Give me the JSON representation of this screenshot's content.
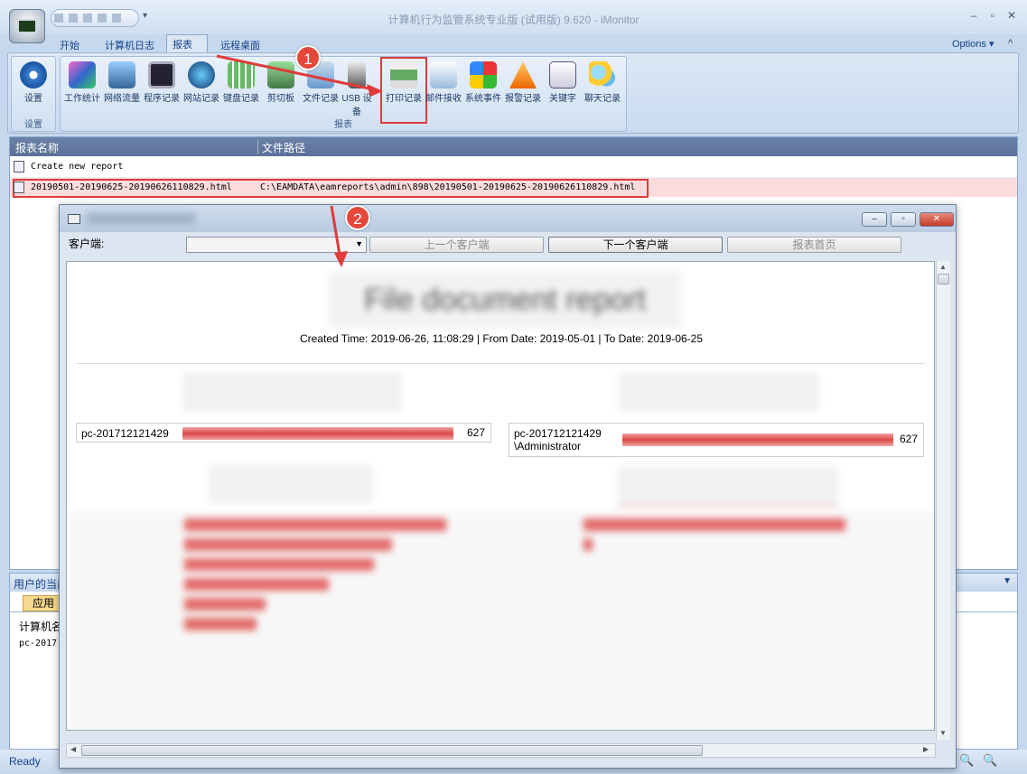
{
  "window": {
    "title": "计算机行为监管系统专业版 (试用版) 9.620 - iMonitor",
    "options_label": "Options"
  },
  "tabs": [
    {
      "label": "开始"
    },
    {
      "label": "计算机日志"
    },
    {
      "label": "报表"
    },
    {
      "label": "远程桌面"
    }
  ],
  "ribbon": {
    "settings_group": {
      "label": "设置",
      "button": "设置"
    },
    "report_group": {
      "label": "报表",
      "buttons": [
        "工作统计",
        "网络流量",
        "程序记录",
        "网站记录",
        "键盘记录",
        "剪切板",
        "文件记录",
        "USB 设备",
        "打印记录",
        "邮件接收",
        "系统事件",
        "报警记录",
        "关键字",
        "聊天记录"
      ]
    }
  },
  "report_list": {
    "columns": [
      "报表名称",
      "文件路径"
    ],
    "rows": [
      {
        "name": "Create new report",
        "path": ""
      },
      {
        "name": "20190501-20190625-20190626110829.html",
        "path": "C:\\EAMDATA\\eamreports\\admin\\898\\20190501-20190625-20190626110829.html"
      }
    ]
  },
  "bottom_panel": {
    "title": "用户的当前",
    "tab": "应用",
    "col": "计算机名",
    "row": "pc-2017"
  },
  "status": {
    "text": "Ready"
  },
  "dialog": {
    "client_label": "客户端:",
    "prev_client": "上一个客户端",
    "next_client": "下一个客户端",
    "report_home": "报表首页",
    "report_title": "File document report",
    "created_line": "Created Time: 2019-06-26, 11:08:29 | From Date: 2019-05-01 | To Date: 2019-06-25",
    "stats": [
      {
        "label": "pc-201712121429",
        "count": "627",
        "fill": 1.0
      },
      {
        "label": "pc-201712121429\n\\Administrator",
        "count": "627",
        "fill": 1.0
      }
    ]
  },
  "annotations": {
    "step1": "1",
    "step2": "2"
  },
  "colors": {
    "accent_red": "#e03b3b",
    "bar_red": "#d94848",
    "ribbon_blue": "#c8dbf0"
  }
}
